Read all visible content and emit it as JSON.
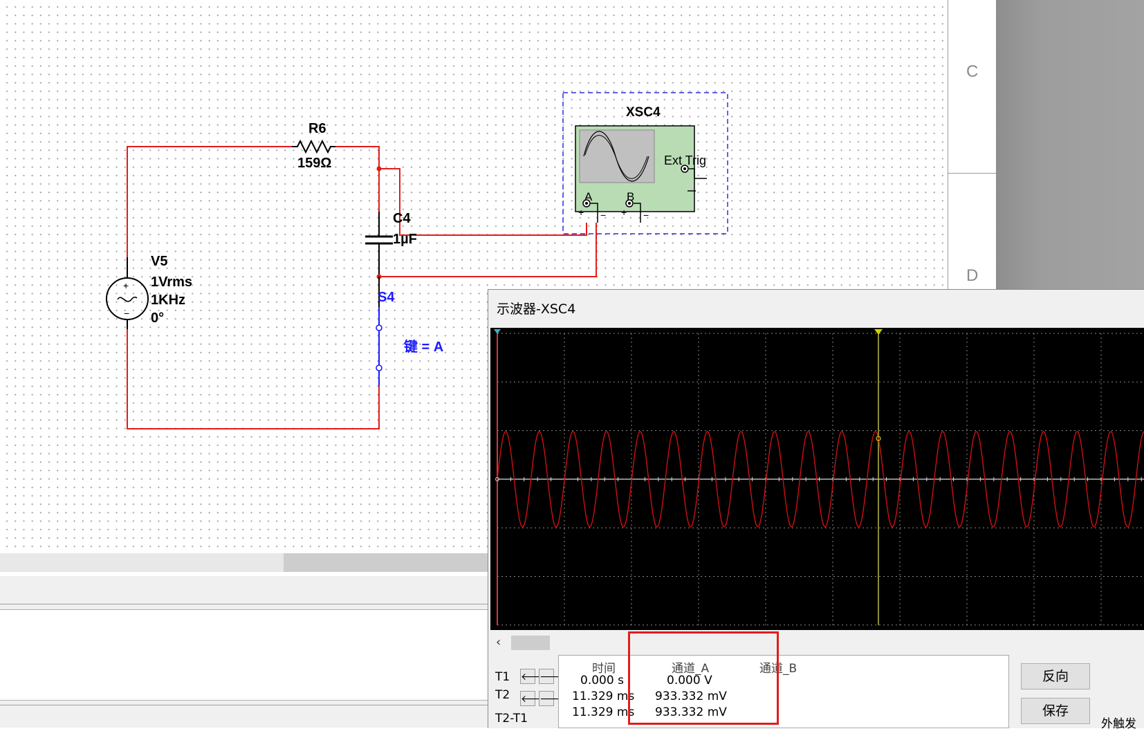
{
  "schematic": {
    "resistor": {
      "name": "R6",
      "value": "159Ω"
    },
    "capacitor": {
      "name": "C4",
      "value": "1µF"
    },
    "source": {
      "name": "V5",
      "amplitude": "1Vrms",
      "frequency": "1KHz",
      "phase": "0°"
    },
    "switch": {
      "name": "S4",
      "key_label": "键 = A"
    },
    "oscilloscope": {
      "name": "XSC4",
      "ext_trig": "Ext Trig",
      "channel_a": "A",
      "channel_b": "B"
    },
    "border_letters": [
      "C",
      "D"
    ]
  },
  "scope_window": {
    "title": "示波器-XSC4",
    "cursor_labels": {
      "t1": "T1",
      "t2": "T2",
      "diff": "T2-T1"
    },
    "columns": {
      "time": "时间",
      "channel_a": "通道_A",
      "channel_b": "通道_B"
    },
    "rows": [
      {
        "time": "0.000 s",
        "channel_a": "0.000 V",
        "channel_b": ""
      },
      {
        "time": "11.329 ms",
        "channel_a": "933.332 mV",
        "channel_b": ""
      },
      {
        "time": "11.329 ms",
        "channel_a": "933.332 mV",
        "channel_b": ""
      }
    ],
    "buttons": {
      "reverse": "反向",
      "save": "保存"
    },
    "ext_trigger_label": "外触发"
  },
  "colors": {
    "wire": "#e31b1b",
    "switch": "#1a1aff",
    "trace": "#cc1111",
    "scope_bg": "#000000",
    "grid": "#8a8a8a",
    "cursor": "#c8c84a",
    "scope_body": "#b9dcb4"
  }
}
